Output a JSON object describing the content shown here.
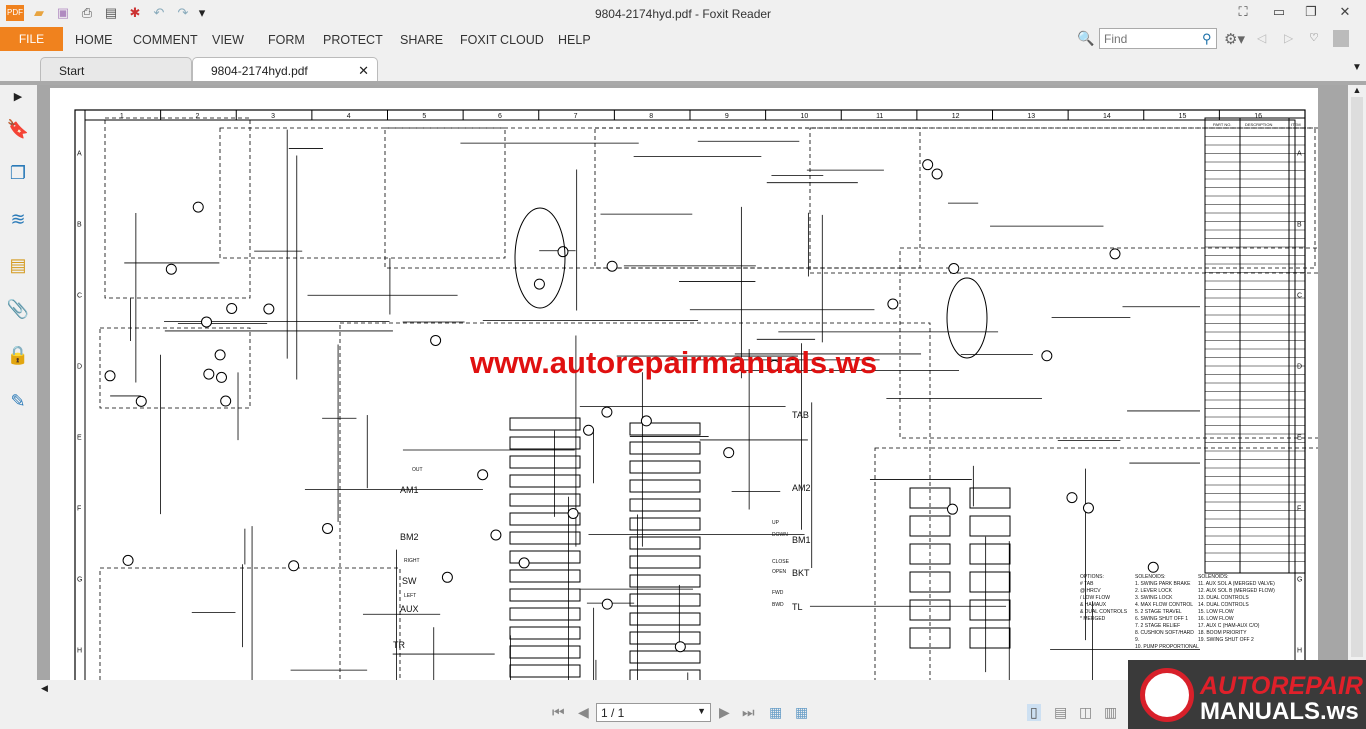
{
  "window": {
    "title": "9804-2174hyd.pdf - Foxit Reader"
  },
  "quick_access": [
    "pdf-logo-icon",
    "open-icon",
    "save-icon",
    "print-icon",
    "properties-icon",
    "new-icon",
    "undo-icon",
    "redo-icon",
    "customize-icon"
  ],
  "menu": {
    "file": "FILE",
    "items": [
      "HOME",
      "COMMENT",
      "VIEW",
      "FORM",
      "PROTECT",
      "SHARE",
      "FOXIT CLOUD",
      "HELP"
    ]
  },
  "search": {
    "placeholder": "Find"
  },
  "tabs": [
    {
      "label": "Start"
    },
    {
      "label": "9804-2174hyd.pdf",
      "active": true
    }
  ],
  "sidebar": [
    "bookmark-icon",
    "pages-icon",
    "layers-icon",
    "comments-icon",
    "attachments-icon",
    "security-icon",
    "signature-icon"
  ],
  "document": {
    "watermark": "www.autorepairmanuals.ws",
    "columns": [
      "1",
      "2",
      "3",
      "4",
      "5",
      "6",
      "7",
      "8",
      "9",
      "10",
      "11",
      "12",
      "13",
      "14",
      "15",
      "16"
    ],
    "rows": [
      "A",
      "B",
      "C",
      "D",
      "E",
      "F",
      "G",
      "H"
    ],
    "labels": {
      "am1": "AM1",
      "am2": "AM2",
      "bm1": "BM1",
      "bm2": "BM2",
      "sw": "SW",
      "aux": "AUX",
      "tr": "TR",
      "tab": "TAB",
      "bkt": "BKT",
      "tl": "TL",
      "out": "OUT",
      "up": "UP",
      "down": "DOWN",
      "close": "CLOSE",
      "open": "OPEN",
      "right": "RIGHT",
      "left": "LEFT",
      "fwd": "FWD",
      "bwd": "BWD"
    },
    "table_headers": [
      "PART NO.",
      "DESCRIPTION",
      "ITEM"
    ],
    "options": {
      "title": "OPTIONS:",
      "items": [
        "# TAB",
        "@ HRCV",
        "/ LOW FLOW",
        "& HAMAUX",
        "& DUAL CONTROLS",
        "* MERGED"
      ]
    },
    "solenoids1": {
      "title": "SOLENOIDS:",
      "items": [
        "1. SWING PARK BRAKE",
        "2. LEVER LOCK",
        "3. SWING LOCK",
        "4. MAX FLOW CONTROL",
        "5. 2 STAGE TRAVEL",
        "6. SWING SHUT OFF 1",
        "7. 2 STAGE RELIEF",
        "8. CUSHION SOFT/HARD",
        "9.",
        "10. PUMP PROPORTIONAL"
      ]
    },
    "solenoids2": {
      "title": "SOLENOIDS:",
      "items": [
        "11. AUX SOL A (MERGED VALVE)",
        "12. AUX SOL B (MERGED FLOW)",
        "13. DUAL CONTROLS",
        "14. DUAL CONTROLS",
        "15. LOW FLOW",
        "16. LOW FLOW",
        "17. AUX C (HAM-AUX C/O)",
        "18. BOOM PRIORITY",
        "19. SWING SHUT OFF 2"
      ]
    }
  },
  "status": {
    "page": "1 / 1"
  },
  "logo": {
    "line1": "AUTOREPAIR",
    "line2": "MANUALS.ws"
  },
  "colors": {
    "accent": "#f0821e",
    "watermark": "#e01010"
  }
}
